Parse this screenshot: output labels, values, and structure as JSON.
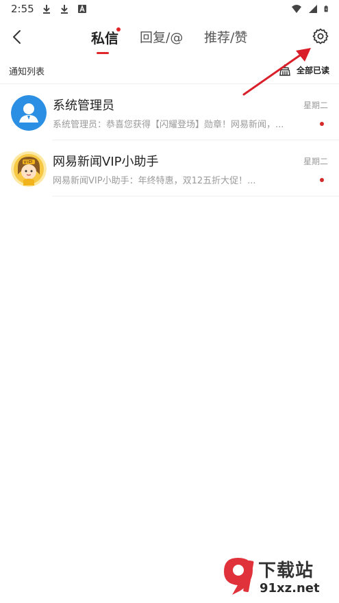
{
  "status_bar": {
    "time": "2:55",
    "left_icons": [
      "download-icon",
      "download-icon",
      "font-a-icon"
    ],
    "right_icons": [
      "wifi-icon",
      "signal-icon",
      "battery-charging-icon"
    ]
  },
  "header": {
    "tabs": [
      {
        "label": "私信",
        "active": true,
        "has_dot": true
      },
      {
        "label": "回复/@",
        "active": false,
        "has_dot": false
      },
      {
        "label": "推荐/赞",
        "active": false,
        "has_dot": false
      }
    ],
    "accent_color": "#e0262b"
  },
  "section": {
    "title": "通知列表",
    "mark_all_label": "全部已读"
  },
  "messages": [
    {
      "name": "系统管理员",
      "time": "星期二",
      "preview": "系统管理员：恭喜您获得【闪耀登场】勋章！网易新闻，...",
      "unread": true,
      "avatar": "admin-avatar"
    },
    {
      "name": "网易新闻VIP小助手",
      "time": "星期二",
      "preview": "网易新闻VIP小助手：年终特惠，双12五折大促！...",
      "unread": true,
      "avatar": "vip-assistant-avatar"
    }
  ],
  "watermark": {
    "logo_text": "9",
    "title": "下载站",
    "domain": "91xz.net"
  }
}
